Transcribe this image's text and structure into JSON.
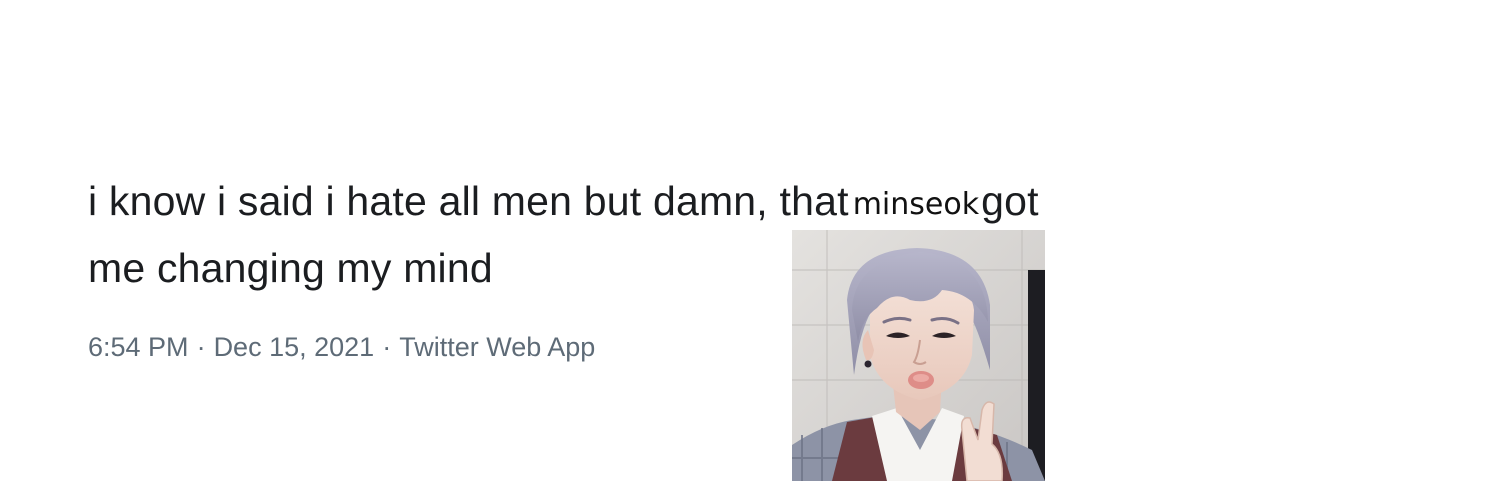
{
  "tweet": {
    "text_part1": "i know i said i hate all men but damn, that",
    "overlay_word": "minseok",
    "text_part2": "got",
    "line2": "me changing my mind"
  },
  "meta": {
    "time": "6:54 PM",
    "separator": "·",
    "date": "Dec 15, 2021",
    "source": "Twitter Web App"
  },
  "photo": {
    "subject": "selfie-portrait",
    "colors": {
      "hair": "#a7a6bd",
      "skin": "#f0d9cf",
      "lips": "#de8d88",
      "background": "#d8d6d4",
      "jacket": "#6b3b3f"
    }
  }
}
